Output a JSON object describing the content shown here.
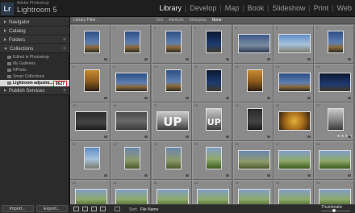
{
  "app": {
    "badge": "Lr",
    "brand_small": "Adobe Photoshop",
    "brand_name": "Lightroom 5"
  },
  "modules": [
    "Library",
    "Develop",
    "Map",
    "Book",
    "Slideshow",
    "Print",
    "Web"
  ],
  "active_module": "Library",
  "left_panel": {
    "navigator": "Navigator",
    "catalog": "Catalog",
    "folders": "Folders",
    "collections": "Collections",
    "collection_items": [
      {
        "label": "Edited in Photoshop",
        "count": ""
      },
      {
        "label": "My Galleries",
        "count": ""
      },
      {
        "label": "NPhoto",
        "count": ""
      },
      {
        "label": "Smart Collections",
        "count": ""
      },
      {
        "label": "Lightroom adjustm...",
        "count": "8627"
      }
    ],
    "publish_services": "Publish Services"
  },
  "buttons": {
    "import": "Import...",
    "export": "Export..."
  },
  "filter_bar": {
    "label": "Library Filter :",
    "tabs": [
      "Text",
      "Attribute",
      "Metadata",
      "None"
    ],
    "active": "None"
  },
  "thumbnails": [
    {
      "num": "1",
      "style": "t-dusk"
    },
    {
      "num": "2",
      "style": "t-dusk"
    },
    {
      "num": "3",
      "style": "t-dusk"
    },
    {
      "num": "4",
      "style": "t-night"
    },
    {
      "num": "5",
      "style": "t-ship"
    },
    {
      "num": "6",
      "style": "t-sky"
    },
    {
      "num": "7",
      "style": "t-dusk"
    },
    {
      "num": "8",
      "style": "t-gold"
    },
    {
      "num": "9",
      "style": "t-dusk"
    },
    {
      "num": "10",
      "style": "t-dusk"
    },
    {
      "num": "11",
      "style": "t-night"
    },
    {
      "num": "12",
      "style": "t-gold"
    },
    {
      "num": "13",
      "style": "t-dusk"
    },
    {
      "num": "14",
      "style": "t-night"
    },
    {
      "num": "15",
      "style": "t-dark"
    },
    {
      "num": "16",
      "style": "t-street"
    },
    {
      "num": "17",
      "style": "t-bw"
    },
    {
      "num": "18",
      "style": "t-bw"
    },
    {
      "num": "19",
      "style": "t-dark"
    },
    {
      "num": "20",
      "style": "t-yellow"
    },
    {
      "num": "21",
      "style": "t-bw"
    },
    {
      "num": "22",
      "style": "t-sky"
    },
    {
      "num": "23",
      "style": "t-stone"
    },
    {
      "num": "24",
      "style": "t-stone"
    },
    {
      "num": "25",
      "style": "t-green"
    },
    {
      "num": "26",
      "style": "t-stone"
    },
    {
      "num": "27",
      "style": "t-green"
    },
    {
      "num": "28",
      "style": "t-green"
    },
    {
      "num": "29",
      "style": "t-green"
    },
    {
      "num": "30",
      "style": "t-green"
    },
    {
      "num": "31",
      "style": "t-green"
    },
    {
      "num": "32",
      "style": "t-green"
    },
    {
      "num": "33",
      "style": "t-green"
    },
    {
      "num": "34",
      "style": "t-green"
    },
    {
      "num": "35",
      "style": "t-green"
    }
  ],
  "up_label": "UP",
  "stars": "★★★★",
  "toolbar": {
    "sort_label": "Sort:",
    "sort_value": "File Name",
    "thumbnails_label": "Thumbnails"
  }
}
